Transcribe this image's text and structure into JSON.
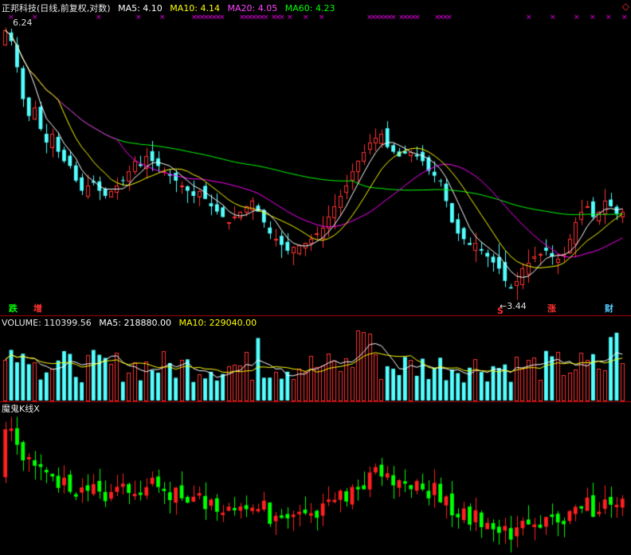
{
  "price_panel": {
    "title": "正邦科技(日线,前复权,对数)",
    "ma5": "MA5: 4.10",
    "ma10": "MA10: 4.14",
    "ma20": "MA20: 4.05",
    "ma60": "MA60: 4.23",
    "high_label": "6.24",
    "low_label": "3.44",
    "badges": {
      "die": "跌",
      "zeng": "增",
      "s": "S",
      "zhang": "涨",
      "cai": "财"
    }
  },
  "volume_panel": {
    "volume": "VOLUME: 110399.56",
    "ma5": "MA5: 218880.00",
    "ma10": "MA10: 229040.00"
  },
  "indicator_panel": {
    "title": "魔鬼K线X"
  },
  "colors": {
    "up": "#ff3232",
    "down": "#54ffff",
    "ma5": "#ffffff",
    "ma10": "#ffff00",
    "ma20": "#ff00ff",
    "ma60": "#00ff00",
    "separator": "#b00000",
    "magic_up": "#ff2020",
    "magic_down": "#00ff00"
  },
  "chart_data": {
    "type": "candlestick",
    "series_closes": [
      6.2,
      6.05,
      5.7,
      5.3,
      5.1,
      5.2,
      4.95,
      4.8,
      4.9,
      4.7,
      4.6,
      4.55,
      4.4,
      4.3,
      4.35,
      4.38,
      4.3,
      4.25,
      4.3,
      4.35,
      4.4,
      4.5,
      4.6,
      4.55,
      4.65,
      4.6,
      4.55,
      4.5,
      4.45,
      4.4,
      4.35,
      4.3,
      4.25,
      4.3,
      4.22,
      4.15,
      4.1,
      4.05,
      4.0,
      4.05,
      4.1,
      4.15,
      4.2,
      4.1,
      4.0,
      3.9,
      3.85,
      3.8,
      3.75,
      3.78,
      3.8,
      3.82,
      3.85,
      3.9,
      3.95,
      4.05,
      4.15,
      4.25,
      4.35,
      4.5,
      4.6,
      4.7,
      4.8,
      4.85,
      4.9,
      4.75,
      4.7,
      4.65,
      4.68,
      4.7,
      4.65,
      4.6,
      4.5,
      4.45,
      4.4,
      4.2,
      4.0,
      3.9,
      3.85,
      3.8,
      3.82,
      3.75,
      3.7,
      3.65,
      3.6,
      3.5,
      3.44,
      3.5,
      3.6,
      3.65,
      3.7,
      3.72,
      3.75,
      3.7,
      3.68,
      3.72,
      3.85,
      4.0,
      4.1,
      4.15,
      4.05,
      4.1,
      4.2,
      4.15,
      4.08,
      4.1
    ],
    "low": 3.44,
    "high": 6.24
  }
}
